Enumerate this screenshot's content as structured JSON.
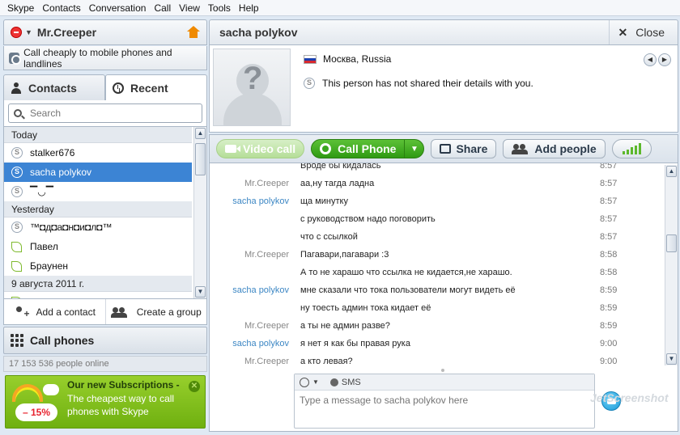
{
  "menu": [
    "Skype",
    "Contacts",
    "Conversation",
    "Call",
    "View",
    "Tools",
    "Help"
  ],
  "profile": {
    "name": "Mr.Creeper"
  },
  "call_cheaply": "Call cheaply to mobile phones and landlines",
  "tabs": {
    "contacts": "Contacts",
    "recent": "Recent"
  },
  "search": {
    "placeholder": "Search"
  },
  "recent_list": {
    "group_today": "Today",
    "today": [
      "stalker676",
      "sacha polykov",
      "▔◡▔"
    ],
    "group_yesterday": "Yesterday",
    "yesterday": [
      "™◘д◘а◘н◘и◘л◘™",
      "Павел",
      "Браунен"
    ],
    "group_date": "9 августа 2011 г."
  },
  "actions": {
    "add_contact": "Add a contact",
    "create_group": "Create a group"
  },
  "call_phones": "Call phones",
  "online_count": "17 153 536 people online",
  "promo": {
    "title": "Our new Subscriptions -",
    "body": "The cheapest way to call phones with Skype",
    "discount": "– 15%"
  },
  "conversation": {
    "name": "sacha polykov",
    "close": "Close",
    "location": "Москва, Russia",
    "details": "This person has not shared their details with you."
  },
  "callbar": {
    "video_call": "Video call",
    "call_phone": "Call Phone",
    "share": "Share",
    "add_people": "Add people"
  },
  "messages": [
    {
      "from": "",
      "text": "Вроде бы кидалась",
      "time": "8:57",
      "other": false
    },
    {
      "from": "Mr.Creeper",
      "text": "аа,ну тагда ладна",
      "time": "8:57",
      "other": false
    },
    {
      "from": "sacha polykov",
      "text": "ща минутку",
      "time": "8:57",
      "other": true
    },
    {
      "from": "",
      "text": "с руководством надо поговорить",
      "time": "8:57",
      "other": true
    },
    {
      "from": "",
      "text": "что с ссылкой",
      "time": "8:57",
      "other": true
    },
    {
      "from": "Mr.Creeper",
      "text": "Пагавари,пагавари :3",
      "time": "8:58",
      "other": false
    },
    {
      "from": "",
      "text": "А то не харашо что ссылка не кидается,не харашо.",
      "time": "8:58",
      "other": false
    },
    {
      "from": "sacha polykov",
      "text": "мне сказали что тока пользователи могут видеть её",
      "time": "8:59",
      "other": true
    },
    {
      "from": "",
      "text": "ну тоесть админ тока кидает её",
      "time": "8:59",
      "other": true
    },
    {
      "from": "Mr.Creeper",
      "text": "а ты не админ разве?",
      "time": "8:59",
      "other": false
    },
    {
      "from": "sacha polykov",
      "text": "я нет я как бы правая рука",
      "time": "9:00",
      "other": true
    },
    {
      "from": "Mr.Creeper",
      "text": "а кто левая?",
      "time": "9:00",
      "other": false
    }
  ],
  "composer": {
    "sms": "SMS",
    "placeholder": "Type a message to sacha polykov here"
  },
  "watermark": "JetScreenshot"
}
